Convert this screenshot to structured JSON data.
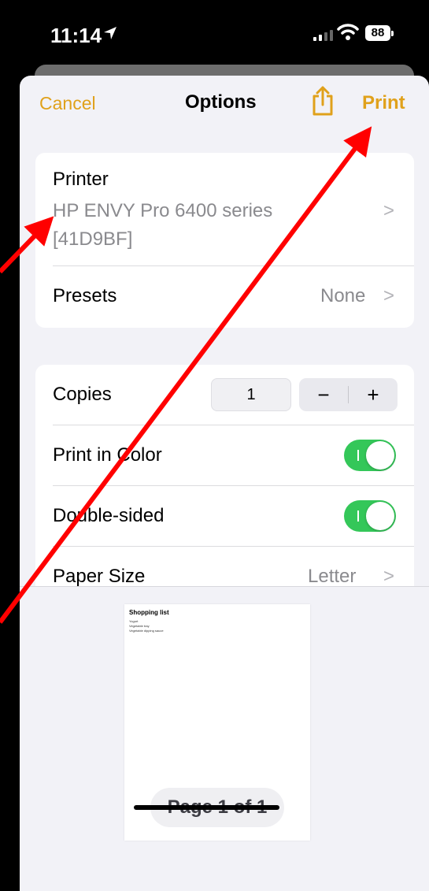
{
  "status_bar": {
    "time": "11:14",
    "battery": "88"
  },
  "nav": {
    "cancel": "Cancel",
    "title": "Options",
    "print": "Print"
  },
  "printer_group": {
    "printer_label": "Printer",
    "printer_name_line1": "HP ENVY Pro 6400 series",
    "printer_name_line2": "[41D9BF]",
    "presets_label": "Presets",
    "presets_value": "None"
  },
  "options_group": {
    "copies_label": "Copies",
    "copies_value": "1",
    "decrement": "−",
    "increment": "+",
    "print_in_color_label": "Print in Color",
    "print_in_color_on": true,
    "double_sided_label": "Double-sided",
    "double_sided_on": true,
    "paper_size_label": "Paper Size",
    "paper_size_value": "Letter"
  },
  "preview": {
    "doc_title": "Shopping list",
    "doc_lines": [
      "Yogurt",
      "Vegetable tray",
      "Vegetable dipping sauce"
    ],
    "page_indicator": "Page 1 of 1"
  },
  "colors": {
    "accent": "#e0a11b",
    "toggle_on": "#34c759",
    "annotation_arrow": "#ff0000"
  }
}
